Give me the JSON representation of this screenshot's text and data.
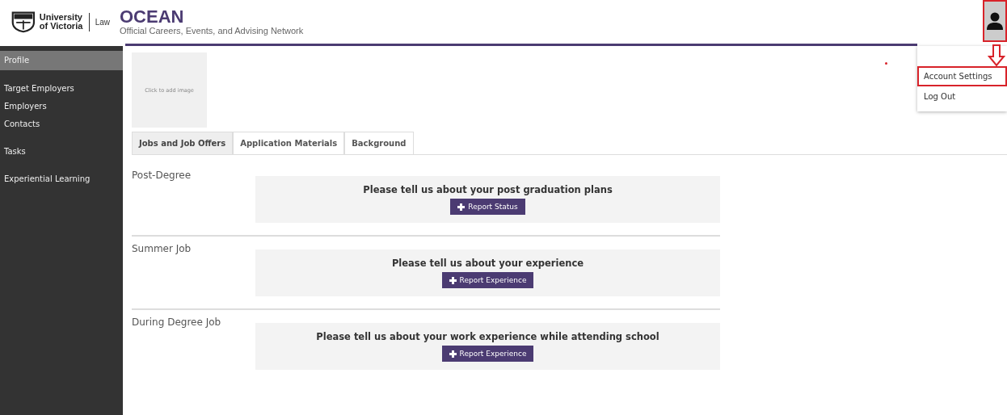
{
  "header": {
    "logo_text": "University of Victoria",
    "faculty": "Law",
    "app_title": "OCEAN",
    "app_subtitle": "Official Careers, Events, and Advising Network"
  },
  "sidebar": {
    "groups": [
      [
        {
          "label": "Profile",
          "selected": true
        }
      ],
      [
        {
          "label": "Target Employers",
          "selected": false
        },
        {
          "label": "Employers",
          "selected": false
        },
        {
          "label": "Contacts",
          "selected": false
        }
      ],
      [
        {
          "label": "Tasks",
          "selected": false
        }
      ],
      [
        {
          "label": "Experiential Learning",
          "selected": false
        }
      ]
    ]
  },
  "profile_image": {
    "placeholder": "Click to add image"
  },
  "tabs": [
    {
      "label": "Jobs and Job Offers",
      "selected": true
    },
    {
      "label": "Application Materials",
      "selected": false
    },
    {
      "label": "Background",
      "selected": false
    }
  ],
  "sections": [
    {
      "title": "Post-Degree",
      "prompt": "Please tell us about your post graduation plans",
      "button": "Report Status"
    },
    {
      "title": "Summer Job",
      "prompt": "Please tell us about your experience",
      "button": "Report Experience"
    },
    {
      "title": "During Degree Job",
      "prompt": "Please tell us about your work experience while attending school",
      "button": "Report Experience"
    }
  ],
  "user_menu": {
    "items": [
      {
        "label": "Account Settings",
        "highlighted": true
      },
      {
        "label": "Log Out",
        "highlighted": false
      }
    ]
  }
}
